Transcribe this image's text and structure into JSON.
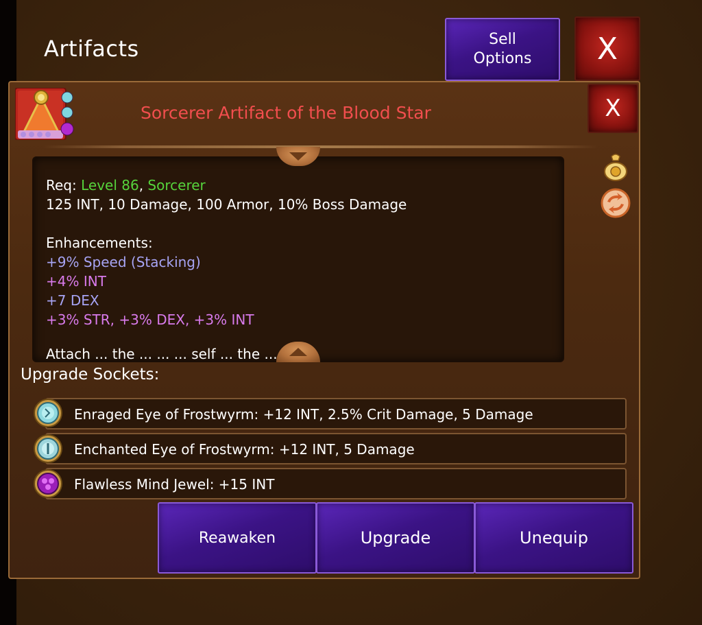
{
  "window": {
    "title": "Artifacts",
    "sell_options_label": "Sell\nOptions",
    "close_label": "X"
  },
  "item": {
    "title": "Sorcerer Artifact of the Blood Star",
    "close_label": "X",
    "req_prefix": "Req: ",
    "req_level": "Level 86",
    "req_sep": ", ",
    "req_class": "Sorcerer",
    "stats": "125 INT, 10 Damage, 100 Armor, 10% Boss Damage",
    "enhancements_header": "Enhancements:",
    "enhancements": [
      "+9% Speed (Stacking)",
      "+4% INT",
      "+7 DEX",
      "+3% STR, +3% DEX, +3% INT"
    ],
    "cut_text": "Attach ... the ... ... ... self ... the ... ... all"
  },
  "sockets": {
    "label": "Upgrade Sockets:",
    "rows": [
      {
        "text": "Enraged Eye of Frostwyrm: +12 INT, 2.5% Crit Damage, 5 Damage",
        "gem": "frost-eye-icon"
      },
      {
        "text": "Enchanted Eye of Frostwyrm: +12 INT, 5 Damage",
        "gem": "frost-eye-icon"
      },
      {
        "text": "Flawless Mind Jewel: +15 INT",
        "gem": "mind-jewel-icon"
      }
    ]
  },
  "actions": {
    "reawaken": "Reawaken",
    "upgrade": "Upgrade",
    "unequip": "Unequip"
  },
  "colors": {
    "title_red": "#f14e4e",
    "req_green": "#56d33c",
    "lavender": "#a7a4f4",
    "pink": "#d97bec",
    "button_purple": "#3b1385"
  }
}
